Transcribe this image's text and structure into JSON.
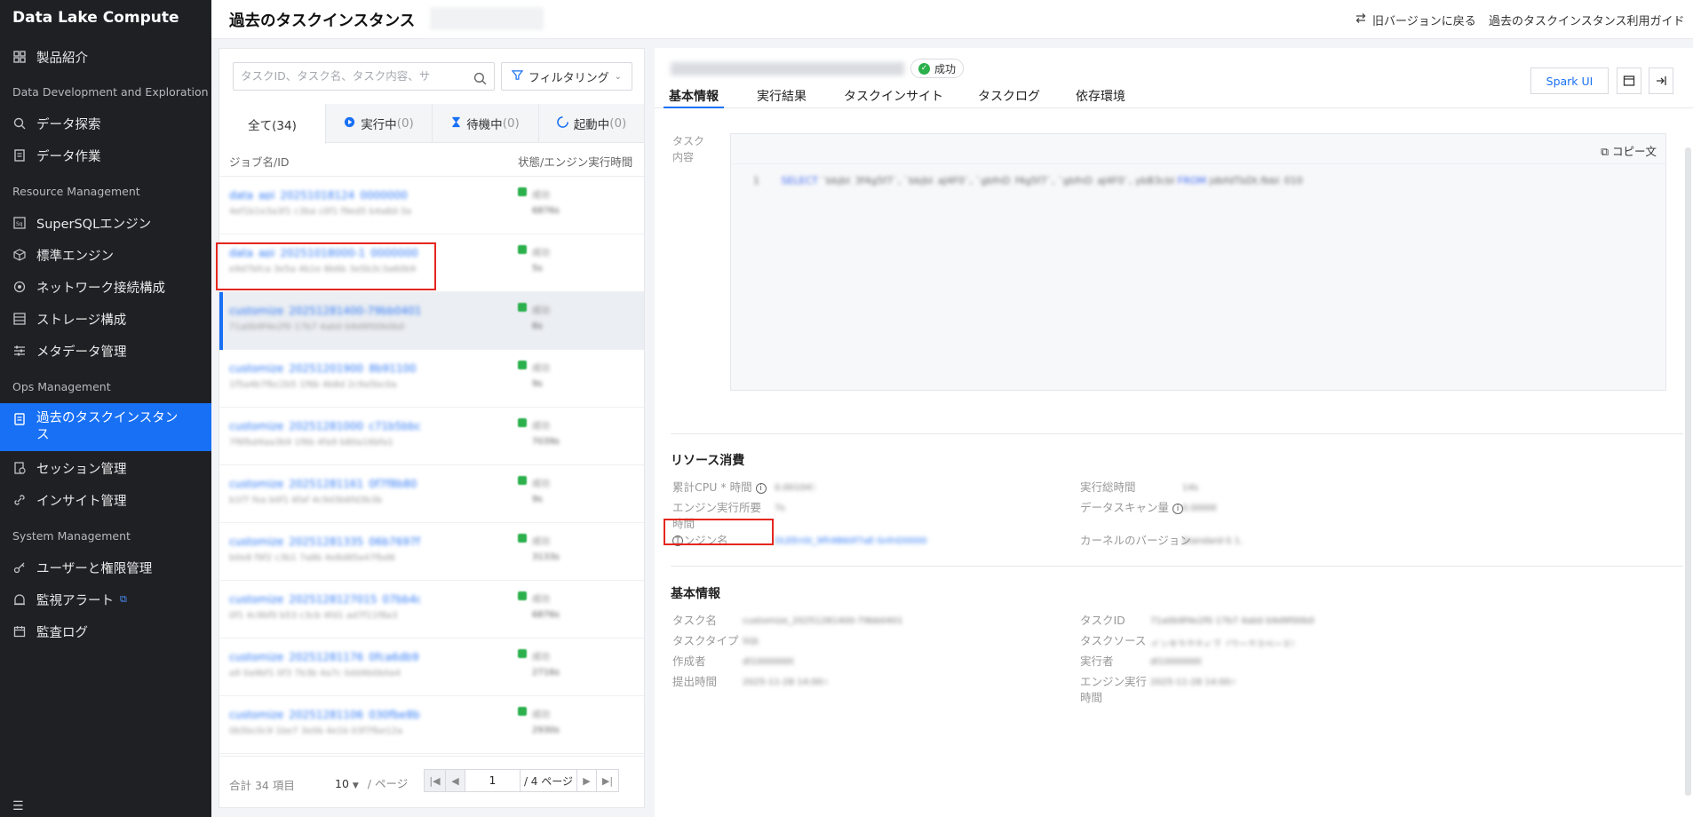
{
  "sidebar": {
    "brand": "Data Lake Compute",
    "product_intro": "製品紹介",
    "section_dev": "Data Development and Exploration",
    "data_explore": "データ探索",
    "data_jobs": "データ作業",
    "section_resource": "Resource Management",
    "supersql": "SuperSQLエンジン",
    "std_engine": "標準エンジン",
    "network": "ネットワーク接続構成",
    "storage": "ストレージ構成",
    "metadata": "メタデータ管理",
    "section_ops": "Ops Management",
    "history_tasks": "過去のタスクインスタンス",
    "sessions": "セッション管理",
    "insights": "インサイト管理",
    "section_system": "System Management",
    "users": "ユーザーと権限管理",
    "alerts": "監視アラート",
    "audit": "監査ログ"
  },
  "header": {
    "title": "過去のタスクインスタンス",
    "old_version": "旧バージョンに戻る",
    "guide": "過去のタスクインスタンス利用ガイド"
  },
  "list": {
    "search_placeholder": "タスクID、タスク名、タスク内容、サ",
    "filter": "フィルタリング",
    "tabs": {
      "all": "全て(34)",
      "running": "実行中",
      "running_cnt": "(0)",
      "waiting": "待機中",
      "waiting_cnt": "(0)",
      "starting": "起動中",
      "starting_cnt": "(0)"
    },
    "col_job": "ジョブ名/ID",
    "col_status": "状態/エンジン実行時間",
    "rows": [
      {
        "name": "data_api_20251018124_0000000",
        "sub": "4ef1b1e3a3f1 c3ba c0f1 f9ed5 b4a8d-3a",
        "status": "成功",
        "time": "6876s"
      },
      {
        "name": "data_api_20251018000-1_0000000",
        "sub": "e9d7bfca 3e5a 4b1e 8b6b 3e5b3c3a60b9",
        "status": "成功",
        "time": "5s"
      },
      {
        "name": "customize_20251281400-79bb0401",
        "sub": "71a0b9f4e2f0 17b7 4ab0 b9d9f00b0b0",
        "status": "成功",
        "time": "6s"
      },
      {
        "name": "customize_20251201900_8b91100",
        "sub": "1f5a4b7fbc2b5 1f6b 4b8d 2c9a5bc0a",
        "status": "成功",
        "time": "9s"
      },
      {
        "name": "customize_20251281000_c71b5bbc",
        "sub": "7f6fbd4aa3b9 1f6b 4fa9 b80a16bfa1",
        "status": "成功",
        "time": "7039s"
      },
      {
        "name": "customize_20251281161_0f7f8b80",
        "sub": "b1f7 fea b0f1 6faf 4c9d3b6fd3b3b",
        "status": "成功",
        "time": "9s"
      },
      {
        "name": "customize_20251281335_06b7697f",
        "sub": "b0e8 f9f2 c3b1 7a8b 4e8d85a47fbd6",
        "status": "成功",
        "time": "3133s"
      },
      {
        "name": "customize_2025128127015_07bb4c75",
        "sub": "0f1 4c9bf0 b53 c3cb 4fd1 ad7f11f8a3",
        "status": "成功",
        "time": "6876s"
      },
      {
        "name": "customize_20251281176_0fca6db9",
        "sub": "a9 0a9bf1 0f3 7b3b 4a7c 0dd4b0b0a4",
        "status": "成功",
        "time": "2716s"
      },
      {
        "name": "customize_20251281106_030fbe8b",
        "sub": "0b5bc0c9 1be7 3e0b 4e1b 03f7fbe12a",
        "status": "成功",
        "time": "2930s"
      }
    ],
    "total_label": "合計 34 項目",
    "per_page": "10",
    "per_page_label": "/ ページ",
    "page": "1",
    "page_total": "/ 4 ページ"
  },
  "detail": {
    "title": "customize_20251281400-79bb0401",
    "status": "成功",
    "spark_ui": "Spark UI",
    "tabs": [
      "基本情報",
      "実行結果",
      "タスクインサイト",
      "タスクログ",
      "依存環境"
    ],
    "task_content_label": "タスク\n内容",
    "copy": "コピー文",
    "code_line_no": "1",
    "code_kw": "SELECT",
    "code": "`bbjbl_3f4g5f7`, `bbjbl_aJ4F0`, `gbfnD_f4g5f7`, `gbfnD_aJ4F0`, ybB3cbl",
    "code_kw2": "FROM",
    "code_tail": "jdbfdTbDt.fbbl_010",
    "resource_title": "リソース消費",
    "cpu_label": "累計CPU * 時間",
    "cpu_value": "0.001047",
    "total_time_label": "実行総時間",
    "total_time_value": "14s",
    "engine_time_label": "エンジン実行所要時間",
    "engine_time_value": "7s",
    "scan_label": "データスキャン量",
    "scan_value": "0.0000B",
    "engine_name_label": "エンジン名",
    "engine_name_value": "DLEEnSt_9fh9B60f7aE-SnfnD0000",
    "kernel_label": "カーネルのバージョン",
    "kernel_value": "Standard-S 1.1",
    "basic_title": "基本情報",
    "task_name_label": "タスク名",
    "task_name_value": "customize_20251281400-79bb0401",
    "task_id_label": "タスクID",
    "task_id_value": "71a0b9f4e2f0 17b7 4ab0 b9d9f00b0b0",
    "task_type_label": "タスクタイプ",
    "task_type_value": "SQL",
    "task_source_label": "タスクソース",
    "task_source_value": "インタラクティブ（ワークスペース）",
    "creator_label": "作成者",
    "creator_value": "dl1000000001",
    "executor_label": "実行者",
    "executor_value": "dl1000000001",
    "submit_label": "提出時間",
    "submit_value": "2025-11-28 14:00:00",
    "engine_exec_label": "エンジン実行\n時間",
    "engine_exec_value": "2025-11-28 14:00:06"
  }
}
